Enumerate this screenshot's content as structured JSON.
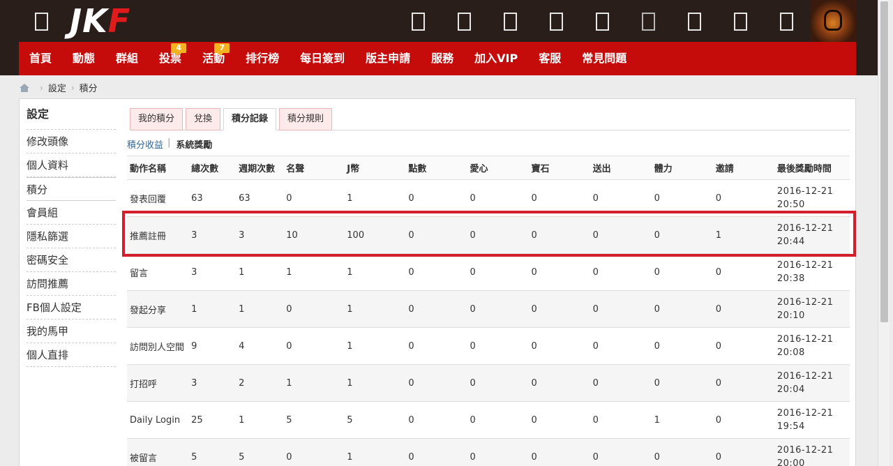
{
  "header": {
    "logo_text": "JK",
    "logo_accent": "F",
    "icons": [
      "menu-icon",
      "search-icon",
      "camera-icon",
      "video-icon",
      "gift-icon",
      "message-icon",
      "notification-icon",
      "friends-icon",
      "mail-icon",
      "settings-icon"
    ]
  },
  "nav": {
    "items": [
      {
        "label": "首頁"
      },
      {
        "label": "動態"
      },
      {
        "label": "群組"
      },
      {
        "label": "投票",
        "badge": "4"
      },
      {
        "label": "活動",
        "badge": "7"
      },
      {
        "label": "排行榜"
      },
      {
        "label": "每日簽到"
      },
      {
        "label": "版主申請"
      },
      {
        "label": "服務"
      },
      {
        "label": "加入VIP"
      },
      {
        "label": "客服"
      },
      {
        "label": "常見問題"
      }
    ]
  },
  "breadcrumb": {
    "items": [
      "設定",
      "積分"
    ]
  },
  "sidebar": {
    "title": "設定",
    "items": [
      "修改頭像",
      "個人資料",
      "積分",
      "會員組",
      "隱私篩選",
      "密碼安全",
      "訪問推薦",
      "FB個人設定",
      "我的馬甲",
      "個人直排"
    ]
  },
  "tabs": [
    "我的積分",
    "兌換",
    "積分記錄",
    "積分規則"
  ],
  "subtabs": {
    "first": "積分收益",
    "second": "系統獎勵"
  },
  "table": {
    "headers": [
      "動作名稱",
      "總次數",
      "週期次數",
      "名聲",
      "J幣",
      "點數",
      "愛心",
      "寶石",
      "送出",
      "體力",
      "邀請",
      "最後獎勵時間"
    ],
    "rows": [
      [
        "發表回覆",
        "63",
        "63",
        "0",
        "1",
        "0",
        "0",
        "0",
        "0",
        "0",
        "0",
        "2016-12-21",
        "20:50"
      ],
      [
        "推薦註冊",
        "3",
        "3",
        "10",
        "100",
        "0",
        "0",
        "0",
        "0",
        "0",
        "1",
        "2016-12-21",
        "20:44"
      ],
      [
        "留言",
        "3",
        "1",
        "1",
        "1",
        "0",
        "0",
        "0",
        "0",
        "0",
        "0",
        "2016-12-21",
        "20:38"
      ],
      [
        "發起分享",
        "1",
        "1",
        "0",
        "1",
        "0",
        "0",
        "0",
        "0",
        "0",
        "0",
        "2016-12-21",
        "20:10"
      ],
      [
        "訪問別人空間",
        "9",
        "4",
        "0",
        "1",
        "0",
        "0",
        "0",
        "0",
        "0",
        "0",
        "2016-12-21",
        "20:08"
      ],
      [
        "打招呼",
        "3",
        "2",
        "1",
        "1",
        "0",
        "0",
        "0",
        "0",
        "0",
        "0",
        "2016-12-21",
        "20:04"
      ],
      [
        "Daily Login",
        "25",
        "1",
        "5",
        "5",
        "0",
        "0",
        "0",
        "0",
        "1",
        "0",
        "2016-12-21",
        "19:54"
      ],
      [
        "被留言",
        "5",
        "5",
        "0",
        "1",
        "0",
        "0",
        "0",
        "0",
        "0",
        "0",
        "2016-12-21",
        "20:00"
      ]
    ]
  },
  "colors": {
    "nav": "#c60b0b",
    "topbar": "#2a1e1a",
    "highlight": "#d31f2c",
    "badge": "#f5b21f"
  }
}
